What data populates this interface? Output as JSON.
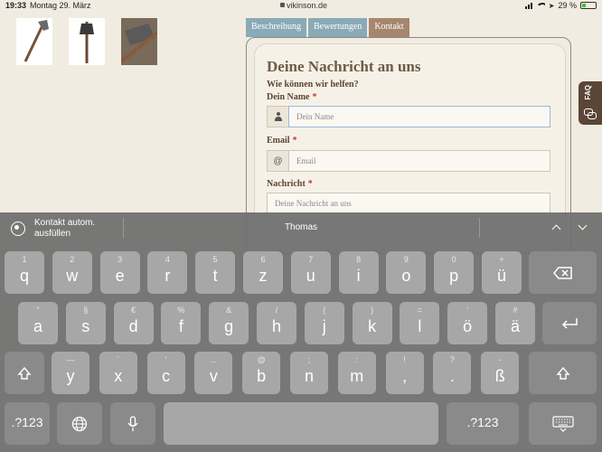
{
  "status": {
    "time": "19:33",
    "date": "Montag 29. März",
    "url": "vikinson.de",
    "battery": "29 %",
    "battery_level": 0.29
  },
  "tabs": [
    {
      "label": "Beschreibung"
    },
    {
      "label": "Bewertungen"
    },
    {
      "label": "Kontakt"
    }
  ],
  "form": {
    "title": "Deine Nachricht an uns",
    "subtitle": "Wie können wir helfen?",
    "name_label": "Dein Name",
    "name_placeholder": "Dein Name",
    "email_label": "Email",
    "email_placeholder": "Email",
    "email_addon": "@",
    "message_label": "Nachricht",
    "message_placeholder": "Deine Nachricht an uns",
    "required_mark": "*"
  },
  "faq": {
    "label": "FAQ"
  },
  "keyboard": {
    "autofill_line1": "Kontakt autom.",
    "autofill_line2": "ausfüllen",
    "suggestion": "Thomas",
    "row1": [
      {
        "alt": "1",
        "main": "q"
      },
      {
        "alt": "2",
        "main": "w"
      },
      {
        "alt": "3",
        "main": "e"
      },
      {
        "alt": "4",
        "main": "r"
      },
      {
        "alt": "5",
        "main": "t"
      },
      {
        "alt": "6",
        "main": "z"
      },
      {
        "alt": "7",
        "main": "u"
      },
      {
        "alt": "8",
        "main": "i"
      },
      {
        "alt": "9",
        "main": "o"
      },
      {
        "alt": "0",
        "main": "p"
      },
      {
        "alt": "+",
        "main": "ü"
      }
    ],
    "row2": [
      {
        "alt": "\"",
        "main": "a"
      },
      {
        "alt": "§",
        "main": "s"
      },
      {
        "alt": "€",
        "main": "d"
      },
      {
        "alt": "%",
        "main": "f"
      },
      {
        "alt": "&",
        "main": "g"
      },
      {
        "alt": "/",
        "main": "h"
      },
      {
        "alt": "(",
        "main": "j"
      },
      {
        "alt": ")",
        "main": "k"
      },
      {
        "alt": "=",
        "main": "l"
      },
      {
        "alt": "'",
        "main": "ö"
      },
      {
        "alt": "#",
        "main": "ä"
      }
    ],
    "row3": [
      {
        "alt": "—",
        "main": "y"
      },
      {
        "alt": "`",
        "main": "x"
      },
      {
        "alt": "'",
        "main": "c"
      },
      {
        "alt": "...",
        "main": "v"
      },
      {
        "alt": "@",
        "main": "b"
      },
      {
        "alt": ";",
        "main": "n"
      },
      {
        "alt": ":",
        "main": "m"
      },
      {
        "alt": "!",
        "main": ","
      },
      {
        "alt": "?",
        "main": "."
      },
      {
        "alt": "-",
        "main": "ß"
      }
    ],
    "numbers_label": ".?123"
  }
}
